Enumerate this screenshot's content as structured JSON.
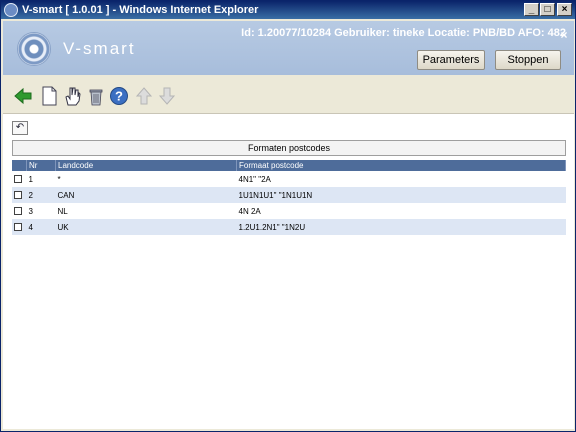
{
  "window": {
    "title": "V-smart [ 1.0.01 ] - Windows Internet Explorer",
    "minimize": "_",
    "maximize": "□",
    "close": "×"
  },
  "header": {
    "brand": "V-smart",
    "info": "Id: 1.20077/10284   Gebruiker: tineke   Locatie: PNB/BD   AFO: 482",
    "parameters_label": "Parameters",
    "stoppen_label": "Stoppen",
    "close_symbol": "×"
  },
  "toolbar": {
    "icons": [
      "back-arrow-icon",
      "new-document-icon",
      "hand-select-icon",
      "delete-trash-icon",
      "help-icon",
      "move-up-icon",
      "move-down-icon"
    ]
  },
  "content": {
    "undo_symbol": "↶",
    "caption": "Formaten postcodes",
    "columns": [
      "Nr",
      "Landcode",
      "Formaat postcode"
    ],
    "rows": [
      {
        "nr": "1",
        "landcode": "*",
        "formaat": "4N1\" \"2A"
      },
      {
        "nr": "2",
        "landcode": "CAN",
        "formaat": "1U1N1U1\" \"1N1U1N"
      },
      {
        "nr": "3",
        "landcode": "NL",
        "formaat": "4N 2A"
      },
      {
        "nr": "4",
        "landcode": "UK",
        "formaat": "1.2U1.2N1\" \"1N2U"
      }
    ]
  },
  "colors": {
    "header_blue": "#a7bddb",
    "table_header": "#4e6c9a",
    "row_alt": "#dde6f4",
    "back_green": "#2e9a2e"
  }
}
